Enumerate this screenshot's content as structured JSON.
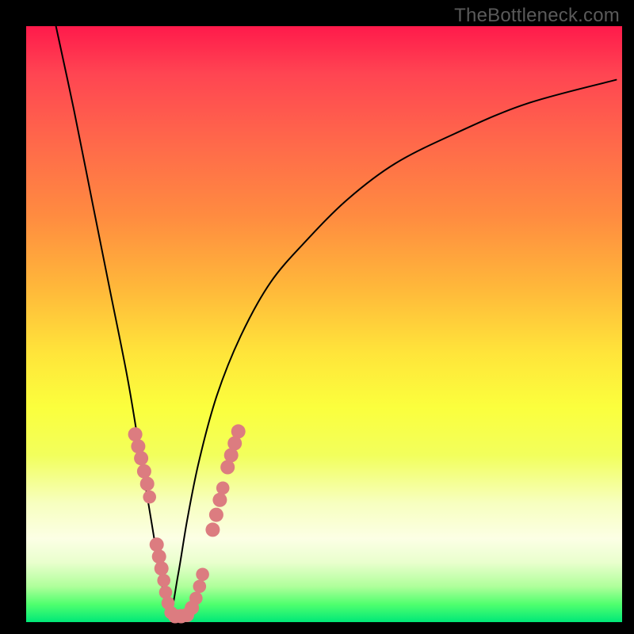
{
  "watermark": "TheBottleneck.com",
  "colors": {
    "frame": "#000000",
    "dot": "#dc7c80",
    "curve": "#000000"
  },
  "chart_data": {
    "type": "line",
    "title": "",
    "xlabel": "",
    "ylabel": "",
    "xlim": [
      0,
      100
    ],
    "ylim": [
      0,
      100
    ],
    "grid": false,
    "curve_note": "V-shaped asymmetric curve: steep descent from top-left to a minimum near x≈24, then a decelerating rise toward the upper right.",
    "series": [
      {
        "name": "curve",
        "x": [
          5,
          8,
          11,
          14,
          17,
          19,
          21,
          22.5,
          24,
          25.5,
          27,
          29,
          32,
          36,
          41,
          47,
          54,
          62,
          72,
          84,
          99
        ],
        "y": [
          100,
          86,
          71,
          56,
          41,
          29,
          17,
          8,
          1,
          8,
          17,
          27,
          38,
          48,
          57,
          64,
          71,
          77,
          82,
          87,
          91
        ]
      }
    ],
    "dots_note": "Pink/salmon circular markers clustered along both flanks of the curve near the minimum and along the bottom.",
    "dots": [
      {
        "x": 18.3,
        "y": 31.5,
        "r": 1.2
      },
      {
        "x": 18.8,
        "y": 29.5,
        "r": 1.2
      },
      {
        "x": 19.3,
        "y": 27.5,
        "r": 1.2
      },
      {
        "x": 19.8,
        "y": 25.3,
        "r": 1.2
      },
      {
        "x": 20.3,
        "y": 23.2,
        "r": 1.2
      },
      {
        "x": 20.7,
        "y": 21.0,
        "r": 1.1
      },
      {
        "x": 21.9,
        "y": 13.0,
        "r": 1.2
      },
      {
        "x": 22.3,
        "y": 11.0,
        "r": 1.2
      },
      {
        "x": 22.7,
        "y": 9.0,
        "r": 1.2
      },
      {
        "x": 23.1,
        "y": 7.0,
        "r": 1.1
      },
      {
        "x": 23.4,
        "y": 5.0,
        "r": 1.1
      },
      {
        "x": 23.8,
        "y": 3.2,
        "r": 1.1
      },
      {
        "x": 24.3,
        "y": 1.6,
        "r": 1.1
      },
      {
        "x": 25.0,
        "y": 1.0,
        "r": 1.2
      },
      {
        "x": 26.0,
        "y": 1.0,
        "r": 1.2
      },
      {
        "x": 27.0,
        "y": 1.2,
        "r": 1.2
      },
      {
        "x": 27.8,
        "y": 2.4,
        "r": 1.2
      },
      {
        "x": 28.5,
        "y": 4.0,
        "r": 1.1
      },
      {
        "x": 29.1,
        "y": 6.0,
        "r": 1.1
      },
      {
        "x": 29.6,
        "y": 8.0,
        "r": 1.1
      },
      {
        "x": 31.3,
        "y": 15.5,
        "r": 1.2
      },
      {
        "x": 31.9,
        "y": 18.0,
        "r": 1.2
      },
      {
        "x": 32.5,
        "y": 20.5,
        "r": 1.2
      },
      {
        "x": 33.0,
        "y": 22.5,
        "r": 1.1
      },
      {
        "x": 33.8,
        "y": 26.0,
        "r": 1.2
      },
      {
        "x": 34.4,
        "y": 28.0,
        "r": 1.2
      },
      {
        "x": 35.0,
        "y": 30.0,
        "r": 1.2
      },
      {
        "x": 35.6,
        "y": 32.0,
        "r": 1.2
      }
    ]
  }
}
